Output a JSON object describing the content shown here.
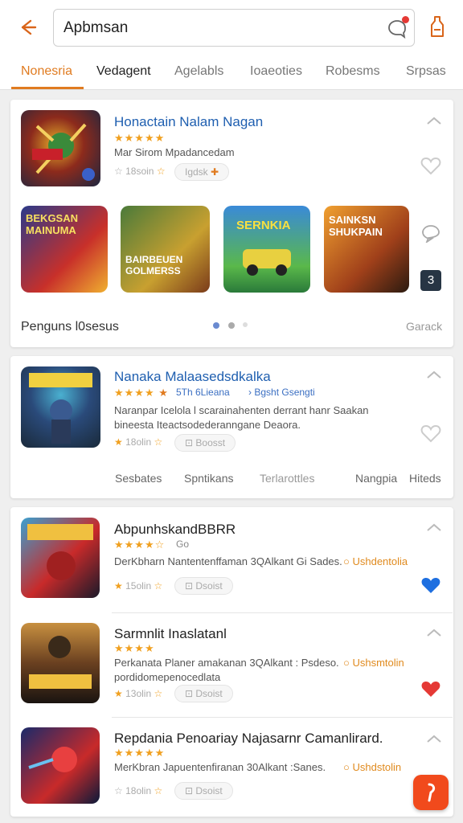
{
  "search": {
    "value": "Apbmsan"
  },
  "tabs": [
    {
      "label": "Nonesria"
    },
    {
      "label": "Vedagent"
    },
    {
      "label": "Agelabls"
    },
    {
      "label": "Ioaeoties"
    },
    {
      "label": "Robesms"
    },
    {
      "label": "Srpsas"
    }
  ],
  "featured": {
    "title": "Honactain Nalam Nagan",
    "stars": "★★★★★",
    "desc": "Mar Sirom Mpadancedam",
    "rating": "18soin",
    "pill": "Igdsk",
    "carousel": [
      {
        "caption": "BEKGSAN MAINUMA"
      },
      {
        "caption": "BAIRBEUEN GOLMERSS"
      },
      {
        "caption": "SERNKIA"
      },
      {
        "caption": "SAINKSN SHUKPAIN"
      }
    ],
    "side_badge": "3",
    "footer_left": "Penguns l0sesus",
    "footer_right": "Garack"
  },
  "second": {
    "title": "Nanaka Malaasedsdkalka",
    "stars": "★★★★",
    "meta_a": "5Th 6Lieana",
    "meta_b": "Bgsht Gsengti",
    "desc1": "Naranpar Icelola l scarainahenten derrant hanr Saakan",
    "desc2": "bineesta Iteactsodederanngane Deaora.",
    "rating": "18olin",
    "pill": "Boosst",
    "subtabs": [
      "Sesbates",
      "Spntikans",
      "Terlarottles",
      "Nangpia",
      "Hiteds"
    ]
  },
  "list": [
    {
      "title": "AbpunhskandBBRR",
      "stars": "★★★★☆",
      "stars_note": "Go",
      "desc": "DerKbharn Nantentenffaman 3QAlkant Gi Sades.",
      "link": "Ushdentolia",
      "desc2": "",
      "rating": "15olin",
      "pill": "Dsoist",
      "heart": "#1e6fe0"
    },
    {
      "title": "Sarmnlit Inaslatanl",
      "stars": "★★★★",
      "stars_note": "",
      "desc": "Perkanata Planer amakanan 3QAlkant : Psdeso.",
      "link": "Ushsmtolin",
      "desc2": "pordidomepenocedlata",
      "rating": "13olin",
      "pill": "Dsoist",
      "heart": "#e53935"
    },
    {
      "title": "Repdania Penoariay Najasarnr Camanlirard.",
      "stars": "★★★★★",
      "stars_note": "",
      "desc": "MerKbran Japuentenfiranan 30Alkant :Sanes.",
      "link": "Ushdstolin",
      "desc2": "",
      "rating": "18olin",
      "pill": "Dsoist",
      "heart": ""
    }
  ],
  "colors": {
    "accent": "#e07b20",
    "link": "#1f5fb0",
    "fab": "#f14a1c"
  }
}
